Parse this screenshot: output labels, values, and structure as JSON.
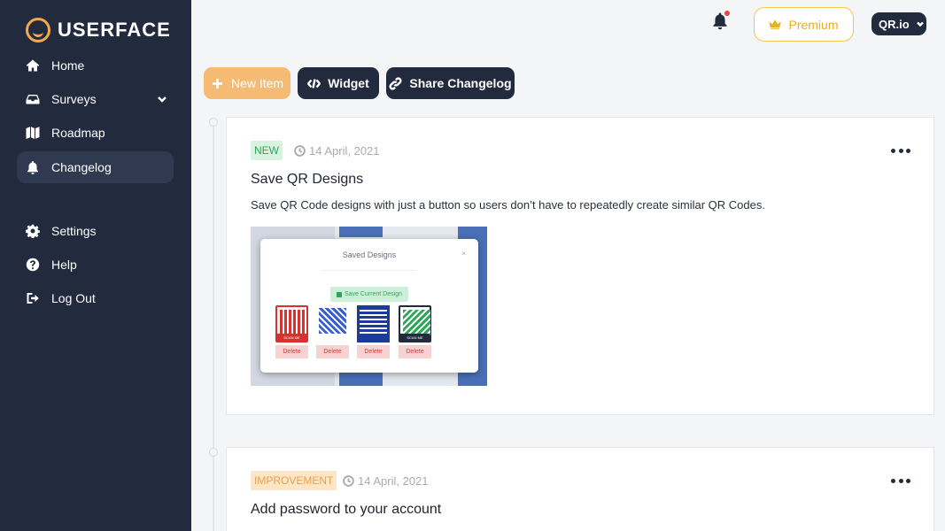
{
  "brand": {
    "name": "USERFACE",
    "accent": "#f5a94a"
  },
  "sidebar": {
    "items": [
      {
        "label": "Home",
        "icon": "home-icon"
      },
      {
        "label": "Surveys",
        "icon": "inbox-icon"
      },
      {
        "label": "Roadmap",
        "icon": "map-icon"
      },
      {
        "label": "Changelog",
        "icon": "bell-icon",
        "active": true
      },
      {
        "label": "Settings",
        "icon": "gear-icon"
      },
      {
        "label": "Help",
        "icon": "question-icon"
      },
      {
        "label": "Log Out",
        "icon": "logout-icon"
      }
    ]
  },
  "header": {
    "premium_label": "Premium",
    "account_label": "QR.io",
    "has_notification": true
  },
  "toolbar": {
    "new_item_label": "New Item",
    "widget_label": "Widget",
    "share_label": "Share Changelog"
  },
  "entries": [
    {
      "badge": "NEW",
      "date": "14 April, 2021",
      "title": "Save QR Designs",
      "description": "Save QR Code designs with just a button so users don’t have to repeatedly create similar QR Codes.",
      "image": {
        "modal_title": "Saved Designs",
        "close_glyph": "×",
        "save_button": "Save Current Design",
        "qr_codes": [
          {
            "color": "#d8322f",
            "frame": true,
            "caption": "SCAN ME"
          },
          {
            "color": "#3a5fd0",
            "frame": false,
            "caption": ""
          },
          {
            "color": "#1c3a9a",
            "frame": true,
            "caption": ""
          },
          {
            "color": "#2fa65a",
            "frame": true,
            "caption": "SCAN ME"
          }
        ],
        "delete_label": "Delete"
      }
    },
    {
      "badge": "IMPROVEMENT",
      "date": "14 April, 2021",
      "title": "Add password to your account"
    }
  ]
}
